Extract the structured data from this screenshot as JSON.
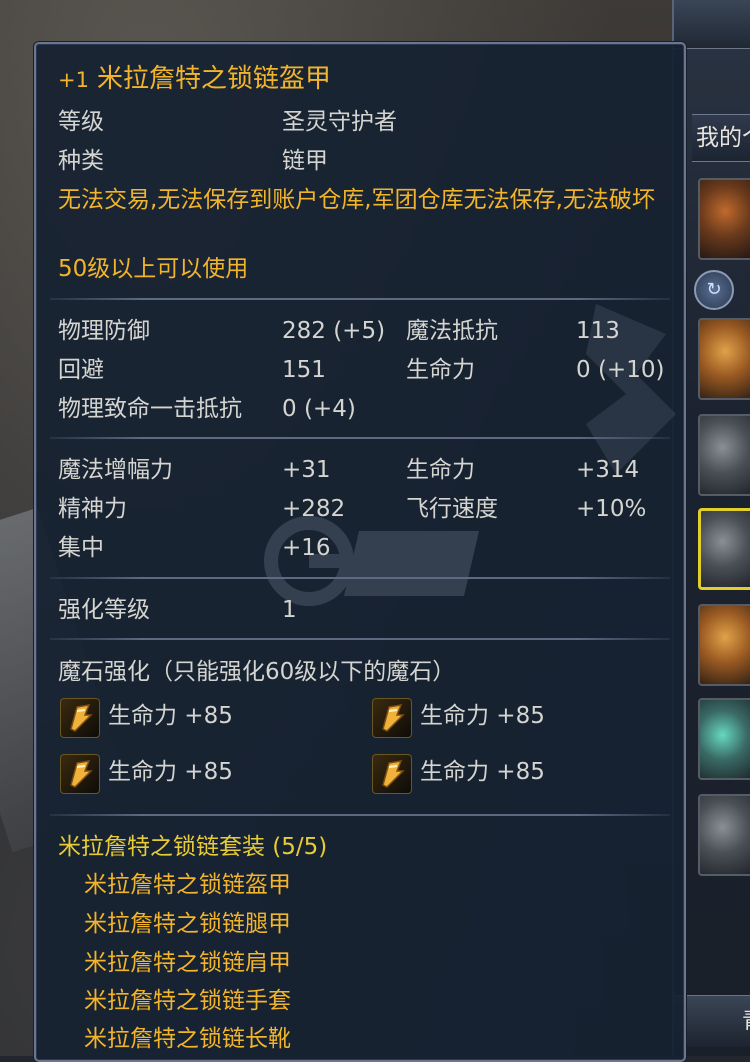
{
  "item": {
    "enchant": "+1",
    "name": "米拉詹特之锁链盔甲"
  },
  "basic": {
    "level_label": "等级",
    "level_value": "圣灵守护者",
    "type_label": "种类",
    "type_value": "链甲",
    "restriction": "无法交易,无法保存到账户仓库,军团仓库无法保存,无法破坏",
    "requirement": "50级以上可以使用"
  },
  "stats": {
    "phys_def_label": "物理防御",
    "phys_def_value": "282 (+5)",
    "magic_res_label": "魔法抵抗",
    "magic_res_value": "113",
    "evasion_label": "回避",
    "evasion_value": "151",
    "hp_label": "生命力",
    "hp_value": "0 (+10)",
    "crit_res_label": "物理致命一击抵抗",
    "crit_res_value": "0 (+4)"
  },
  "bonus": {
    "magic_boost_label": "魔法增幅力",
    "magic_boost_value": "+31",
    "hp_label": "生命力",
    "hp_value": "+314",
    "mp_label": "精神力",
    "mp_value": "+282",
    "fly_label": "飞行速度",
    "fly_value": "+10%",
    "focus_label": "集中",
    "focus_value": "+16"
  },
  "enhance": {
    "label": "强化等级",
    "value": "1"
  },
  "manastones": {
    "heading": "魔石强化（只能强化60级以下的魔石）",
    "slots": [
      {
        "text": "生命力 +85",
        "icon": "manastone-icon"
      },
      {
        "text": "生命力 +85",
        "icon": "manastone-icon"
      },
      {
        "text": "生命力 +85",
        "icon": "manastone-icon"
      },
      {
        "text": "生命力 +85",
        "icon": "manastone-icon"
      }
    ]
  },
  "set": {
    "title": "米拉詹特之锁链套装 (5/5)",
    "pieces": [
      "米拉詹特之锁链盔甲",
      "米拉詹特之锁链腿甲",
      "米拉詹特之锁链肩甲",
      "米拉詹特之锁链手套",
      "米拉詹特之锁链长靴"
    ]
  },
  "side_panel": {
    "title": "我的个",
    "footer": "青"
  },
  "colors": {
    "title": "#f2b42a",
    "set_title": "#e8cc34",
    "text": "#d4d4d0",
    "panel_bg": "#162132",
    "panel_border": "#6b7690",
    "selected_slot": "#e3cf2a"
  }
}
